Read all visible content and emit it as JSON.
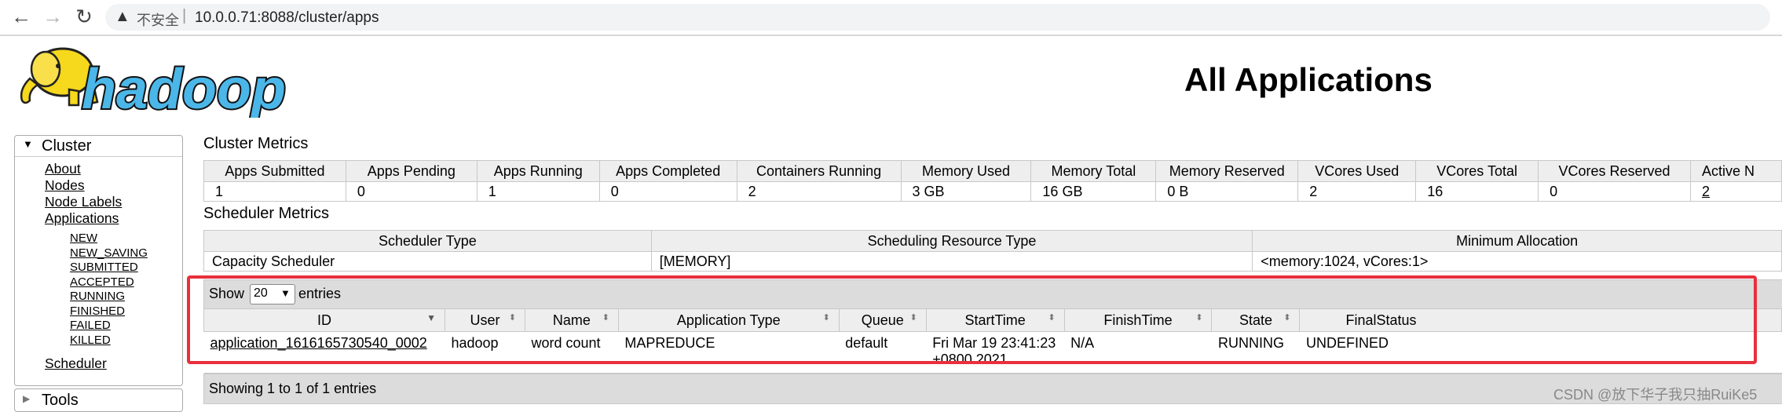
{
  "browser": {
    "insecure_label": "不安全",
    "url": "10.0.0.71:8088/cluster/apps"
  },
  "logo_text": "hadoop",
  "page_title": "All Applications",
  "nav": {
    "cluster_label": "Cluster",
    "links": [
      "About",
      "Nodes",
      "Node Labels",
      "Applications"
    ],
    "states": [
      "NEW",
      "NEW_SAVING",
      "SUBMITTED",
      "ACCEPTED",
      "RUNNING",
      "FINISHED",
      "FAILED",
      "KILLED"
    ],
    "scheduler_link": "Scheduler",
    "tools_label": "Tools"
  },
  "cluster_metrics": {
    "title": "Cluster Metrics",
    "headers": [
      "Apps Submitted",
      "Apps Pending",
      "Apps Running",
      "Apps Completed",
      "Containers Running",
      "Memory Used",
      "Memory Total",
      "Memory Reserved",
      "VCores Used",
      "VCores Total",
      "VCores Reserved",
      "Active N"
    ],
    "values": [
      "1",
      "0",
      "1",
      "0",
      "2",
      "3 GB",
      "16 GB",
      "0 B",
      "2",
      "16",
      "0",
      "2"
    ]
  },
  "scheduler_metrics": {
    "title": "Scheduler Metrics",
    "headers": [
      "Scheduler Type",
      "Scheduling Resource Type",
      "Minimum Allocation"
    ],
    "values": [
      "Capacity Scheduler",
      "[MEMORY]",
      "<memory:1024, vCores:1>"
    ]
  },
  "apps": {
    "show_label": "Show",
    "page_size": "20",
    "entries_label": "entries",
    "headers": [
      "ID",
      "User",
      "Name",
      "Application Type",
      "Queue",
      "StartTime",
      "FinishTime",
      "State",
      "FinalStatus"
    ],
    "rows": [
      {
        "id": "application_1616165730540_0002",
        "user": "hadoop",
        "name": "word count",
        "type": "MAPREDUCE",
        "queue": "default",
        "start": "Fri Mar 19 23:41:23 +0800 2021",
        "finish": "N/A",
        "state": "RUNNING",
        "final_status": "UNDEFINED"
      }
    ],
    "footer": "Showing 1 to 1 of 1 entries"
  },
  "watermark": "CSDN @放下华子我只抽RuiKe5"
}
